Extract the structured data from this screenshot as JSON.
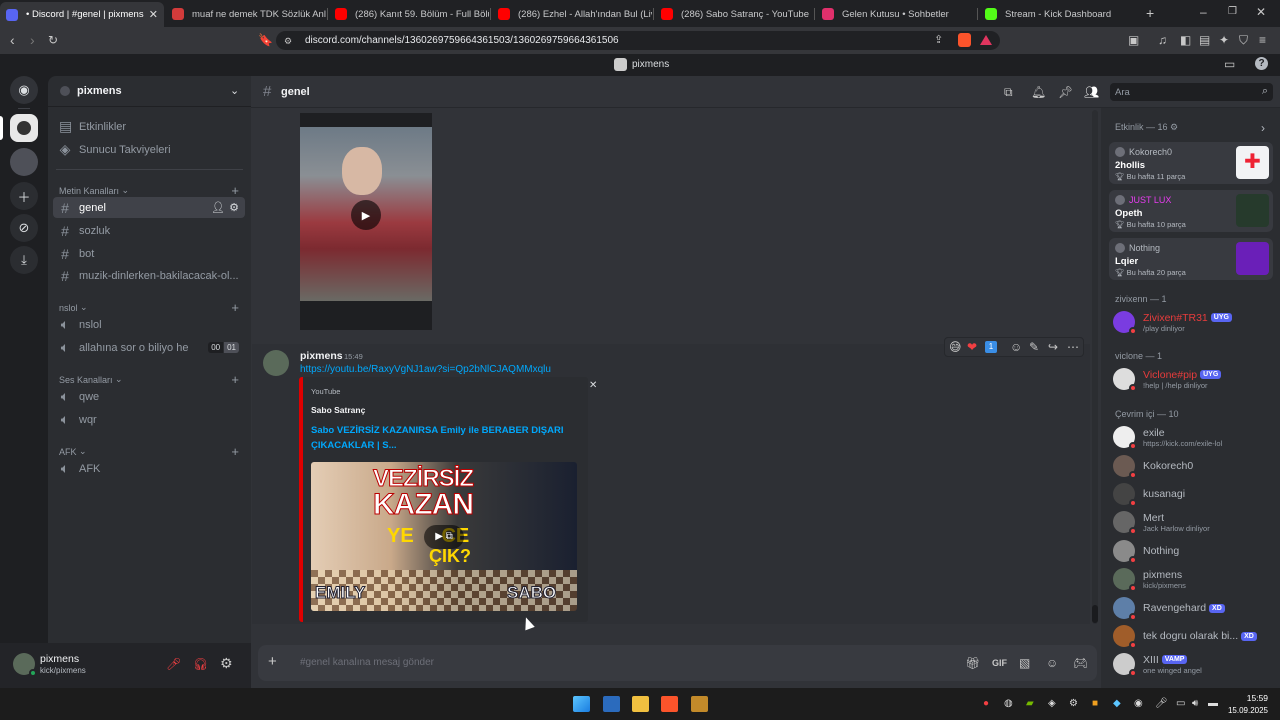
{
  "browser": {
    "tabs": [
      {
        "label": "• Discord | #genel | pixmens",
        "color": "#5865f2",
        "active": true
      },
      {
        "label": "muaf ne demek TDK Sözlük Anlamı",
        "color": "#d23b3b"
      },
      {
        "label": "(286) Kanıt 59. Bölüm - Full Bölüm -",
        "color": "#ff0000"
      },
      {
        "label": "(286) Ezhel - Allah'ından Bul (Live) R",
        "color": "#ff0000"
      },
      {
        "label": "(286) Sabo Satranç - YouTube",
        "color": "#ff0000"
      },
      {
        "label": "Gelen Kutusu • Sohbetler",
        "color": "#e1306c"
      },
      {
        "label": "Stream - Kick Dashboard",
        "color": "#53fc18"
      }
    ],
    "new_tab": "+",
    "url": "discord.com/channels/1360269759664361503/1360269759664361506"
  },
  "discord": {
    "window_title": "pixmens",
    "server_name": "pixmens",
    "nav": [
      {
        "label": "Etkinlikler",
        "icon": "calendar-icon"
      },
      {
        "label": "Sunucu Takviyeleri",
        "icon": "boost-icon"
      }
    ],
    "categories": {
      "text": "Metin Kanalları",
      "nslol": "nslol",
      "voice": "Ses Kanalları",
      "afk": "AFK"
    },
    "text_channels": [
      "genel",
      "sozluk",
      "bot",
      "muzik-dinlerken-bakilacacak-ol..."
    ],
    "nslol_channels": [
      "nslol",
      "allahına sor o biliyo he"
    ],
    "timer": [
      "00",
      "01"
    ],
    "voice_channels": [
      "qwe",
      "wqr"
    ],
    "afk_channels": [
      "AFK"
    ],
    "channel_header": "genel",
    "search_placeholder": "Ara",
    "message": {
      "author": "pixmens",
      "time": "15:49",
      "link": "https://youtu.be/RaxyVgNJ1aw?si=Qp2bNlCJAQMMxqlu",
      "embed_provider": "YouTube",
      "embed_author": "Sabo Satranç",
      "embed_title": "Sabo VEZİRSİZ KAZANIRSA Emily ile BERABER DIŞARI ÇIKACAKLAR | S...",
      "thumb_line1": "VEZİRSİZ",
      "thumb_line2": "KAZAN",
      "thumb_line3": "YE     CE",
      "thumb_line4": "ÇIK?",
      "thumb_left": "EMILY",
      "thumb_right": "SABO",
      "reaction_count": "1"
    },
    "composer_placeholder": "#genel kanalına mesaj gönder",
    "user": {
      "name": "pixmens",
      "status": "kick/pixmens"
    },
    "activity": {
      "header": "Etkinlik — 16",
      "cards": [
        {
          "user": "Kokorech0",
          "title": "2hollis",
          "sub": "Bu hafta 11 parça",
          "user_color": "#b5bac1",
          "img": "#f2f3f5"
        },
        {
          "user": "JUST LUX",
          "title": "Opeth",
          "sub": "Bu hafta 10 parça",
          "user_color": "#e73cf0",
          "img": "#263a2c"
        },
        {
          "user": "Nothing",
          "title": "Lqier",
          "sub": "Bu hafta 20 parça",
          "user_color": "#b5bac1",
          "img": "#6a1fb8"
        }
      ]
    },
    "groups": {
      "zivixenn": "zivixenn — 1",
      "viclone": "viclone — 1",
      "online": "Çevrim içi — 10"
    },
    "members": [
      {
        "name": "Zivixen#TR31",
        "status": "/play dinliyor",
        "color": "#e73c3c",
        "badge": "UYG",
        "av": "#7a3ce0"
      },
      {
        "name": "Viclone#pip",
        "status": "!help | /help dinliyor",
        "color": "#e73c3c",
        "badge": "UYG",
        "av": "#dddddd"
      },
      {
        "name": "exile",
        "status": "https://kick.com/exile-lol",
        "color": "#b5bac1",
        "badge": "",
        "av": "#eeeeee"
      },
      {
        "name": "Kokorech0",
        "status": "",
        "color": "#b5bac1",
        "badge": "",
        "av": "#6b5a52"
      },
      {
        "name": "kusanagi",
        "status": "",
        "color": "#b5bac1",
        "badge": "",
        "av": "#444"
      },
      {
        "name": "Mert",
        "status": "Jack Harlow dinliyor",
        "color": "#b5bac1",
        "badge": "",
        "av": "#666"
      },
      {
        "name": "Nothing",
        "status": "",
        "color": "#b5bac1",
        "badge": "",
        "av": "#8a8a8a"
      },
      {
        "name": "pixmens",
        "status": "kick/pixmens",
        "color": "#b5bac1",
        "badge": "",
        "av": "#5a6a5a"
      },
      {
        "name": "Ravengehard",
        "status": "",
        "color": "#b5bac1",
        "badge": "XD",
        "av": "#5e7fa8"
      },
      {
        "name": "tek dogru olarak bi...",
        "status": "",
        "color": "#b5bac1",
        "badge": "XD",
        "av": "#a05d2a"
      },
      {
        "name": "XIII",
        "status": "one winged angel",
        "color": "#b5bac1",
        "badge": "VAMP",
        "av": "#ccc"
      }
    ]
  },
  "taskbar": {
    "time": "15:59",
    "date": "15.09.2025"
  }
}
